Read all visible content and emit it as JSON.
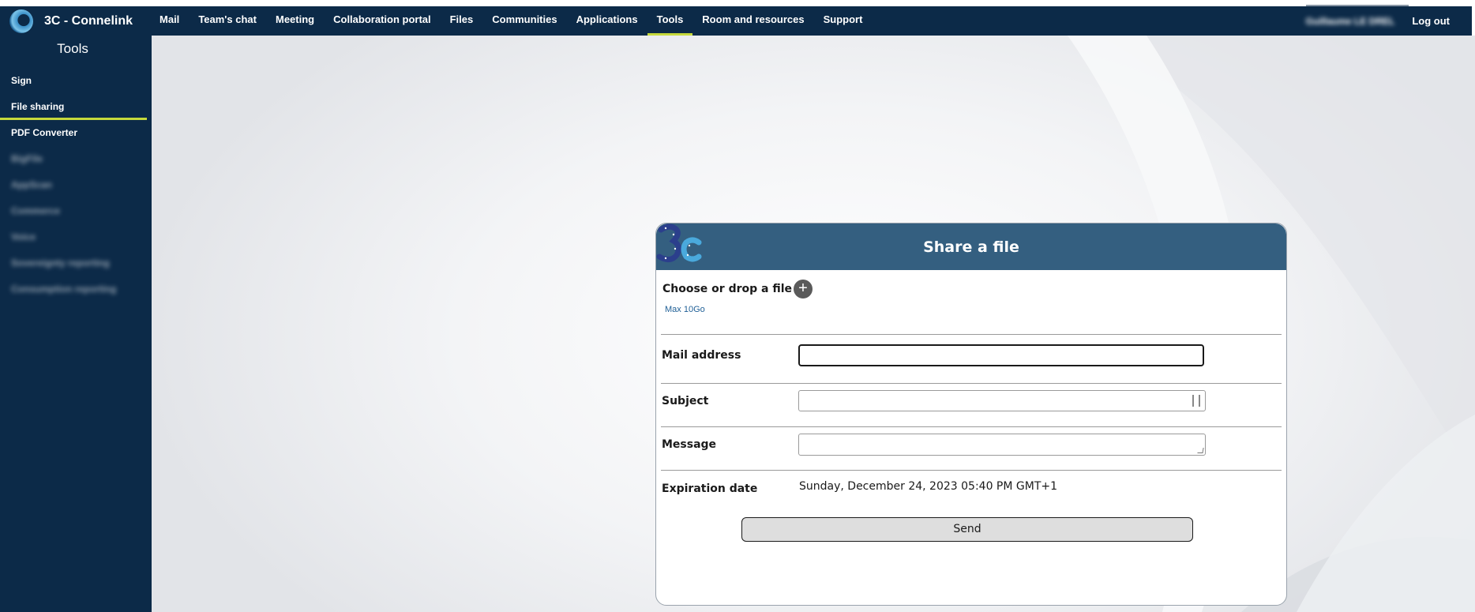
{
  "app": {
    "title": "3C - Connelink"
  },
  "nav": {
    "items": [
      {
        "label": "Mail"
      },
      {
        "label": "Team's chat"
      },
      {
        "label": "Meeting"
      },
      {
        "label": "Collaboration portal"
      },
      {
        "label": "Files"
      },
      {
        "label": "Communities"
      },
      {
        "label": "Applications"
      },
      {
        "label": "Tools",
        "active": true
      },
      {
        "label": "Room and resources"
      },
      {
        "label": "Support"
      }
    ],
    "user_name": "Guillaume LE DREL",
    "logout_label": "Log out"
  },
  "sidebar": {
    "title": "Tools",
    "items": [
      {
        "label": "Sign"
      },
      {
        "label": "File sharing",
        "active": true
      },
      {
        "label": "PDF Converter"
      },
      {
        "label": "BigFile",
        "blurred": true
      },
      {
        "label": "AppScan",
        "blurred": true
      },
      {
        "label": "Commerce",
        "blurred": true
      },
      {
        "label": "Voice",
        "blurred": true
      },
      {
        "label": "Sovereignty reporting",
        "blurred": true
      },
      {
        "label": "Consumption reporting",
        "blurred": true
      }
    ]
  },
  "form": {
    "header": "Share a file",
    "choose_label": "Choose or drop a file",
    "add_icon": "plus-circle-icon",
    "max_note": "Max 10Go",
    "mail_label": "Mail address",
    "mail_value": "",
    "subject_label": "Subject",
    "subject_value": "",
    "message_label": "Message",
    "message_value": "",
    "expiry_label": "Expiration date",
    "expiry_value": "Sunday, December 24, 2023 05:40 PM GMT+1",
    "send_label": "Send"
  },
  "colors": {
    "navy": "#0c2a48",
    "accent": "#c6d93c",
    "card_header": "#345f80",
    "link": "#1f5f96"
  }
}
